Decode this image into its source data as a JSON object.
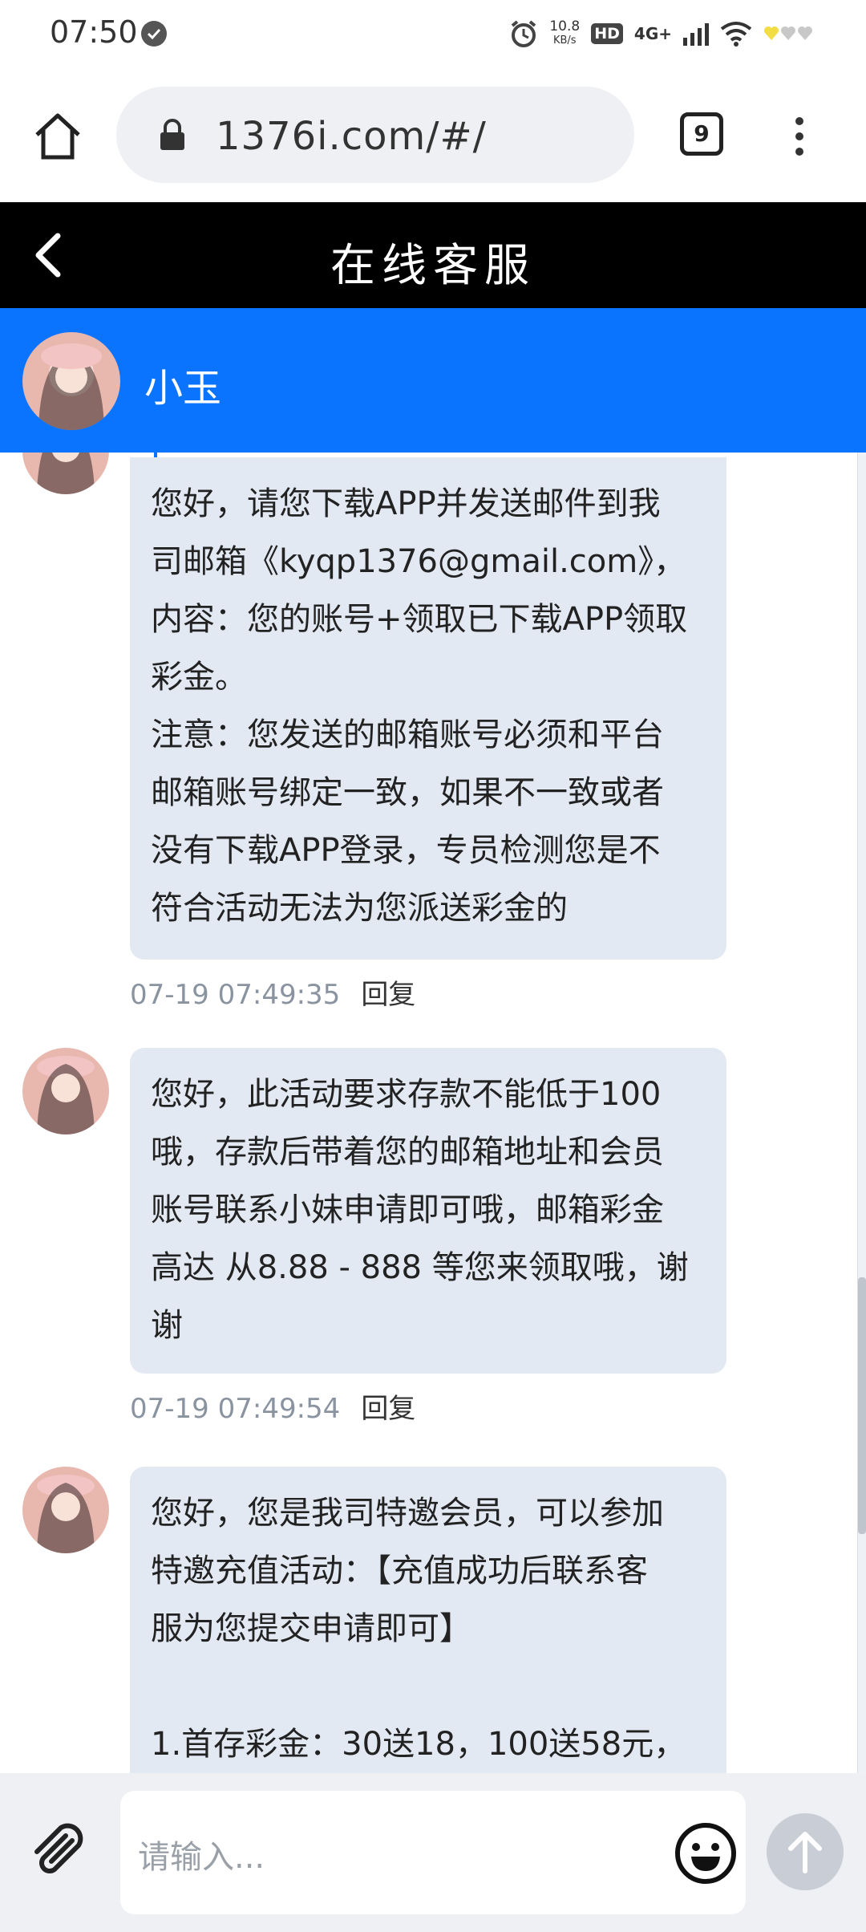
{
  "status_bar": {
    "time": "07:50",
    "speed_value": "10.8",
    "speed_unit": "KB/s",
    "hd": "HD",
    "network": "4G+"
  },
  "browser": {
    "url": "1376i.com/#/",
    "tab_count": "9"
  },
  "header": {
    "title": "在线客服"
  },
  "agent": {
    "name": "小玉"
  },
  "messages": [
    {
      "text": "您好，请您下载APP并发送邮件到我\n司邮箱《kyqp1376@gmail.com》，\n内容：您的账号+领取已下载APP领取\n彩金。\n注意：您发送的邮箱账号必须和平台\n邮箱账号绑定一致，如果不一致或者\n没有下载APP登录，专员检测您是不\n符合活动无法为您派送彩金的",
      "timestamp": "07-19 07:49:35",
      "reply": "回复"
    },
    {
      "text": "您好，此活动要求存款不能低于100\n哦，存款后带着您的邮箱地址和会员\n账号联系小妹申请即可哦，邮箱彩金\n高达 从8.88 - 888 等您来领取哦，谢\n谢",
      "timestamp": "07-19 07:49:54",
      "reply": "回复"
    },
    {
      "text": "您好，您是我司特邀会员，可以参加\n特邀充值活动：【充值成功后联系客\n服为您提交申请即可】\n\n1.首存彩金：30送18，100送58元，"
    }
  ],
  "input": {
    "placeholder": "请输入..."
  },
  "colors": {
    "header_bg": "#000000",
    "agent_bar_bg": "#0a74ff",
    "bubble_bg": "#e3e9f2"
  }
}
